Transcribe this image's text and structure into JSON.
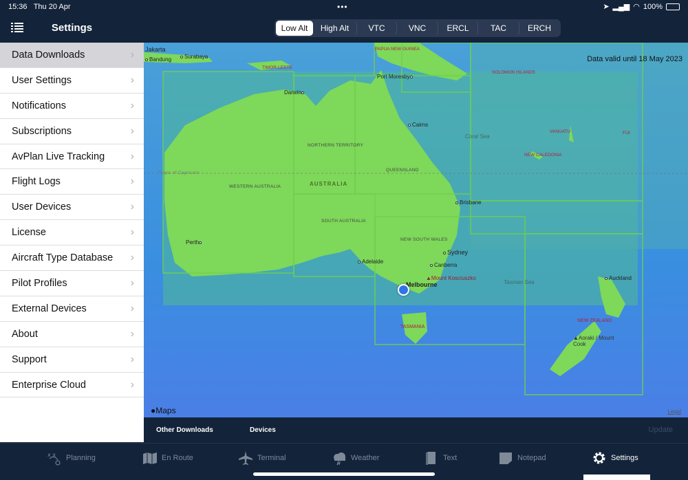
{
  "status": {
    "time": "15:36",
    "date": "Thu 20 Apr",
    "battery": "100%",
    "dots": "•••"
  },
  "sidebar": {
    "title": "Settings",
    "items": [
      {
        "label": "Data Downloads",
        "active": true
      },
      {
        "label": "User Settings"
      },
      {
        "label": "Notifications"
      },
      {
        "label": "Subscriptions"
      },
      {
        "label": "AvPlan Live Tracking"
      },
      {
        "label": "Flight Logs"
      },
      {
        "label": "User Devices"
      },
      {
        "label": "License"
      },
      {
        "label": "Aircraft Type Database"
      },
      {
        "label": "Pilot Profiles"
      },
      {
        "label": "External Devices"
      },
      {
        "label": "About"
      },
      {
        "label": "Support"
      },
      {
        "label": "Enterprise Cloud"
      }
    ]
  },
  "chart_tabs": [
    {
      "label": "Low Alt",
      "selected": true
    },
    {
      "label": "High Alt"
    },
    {
      "label": "VTC"
    },
    {
      "label": "VNC"
    },
    {
      "label": "ERCL"
    },
    {
      "label": "TAC"
    },
    {
      "label": "ERCH"
    }
  ],
  "map": {
    "validity": "Data valid until 18 May 2023",
    "attribution": "Maps",
    "legal": "Legal",
    "labels": {
      "jakarta": "Jakarta",
      "bandung": "Bandung",
      "surabaya": "Surabaya",
      "timor_leste": "TIMOR-LESTE",
      "png": "PAPUA NEW GUINEA",
      "port_moresby": "Port Moresby",
      "solomon": "SOLOMON ISLANDS",
      "darwin": "Darwin",
      "cairns": "Cairns",
      "coral_sea": "Coral Sea",
      "vanuatu": "VANUATU",
      "fiji": "FIJI",
      "new_caledonia": "NEW CALEDONIA",
      "northern_territory": "NORTHERN TERRITORY",
      "australia": "AUSTRALIA",
      "queensland": "QUEENSLAND",
      "tropic": "Tropic of Capricorn",
      "western_australia": "WESTERN AUSTRALIA",
      "brisbane": "Brisbane",
      "south_australia": "SOUTH AUSTRALIA",
      "perth": "Perth",
      "nsw": "NEW SOUTH WALES",
      "sydney": "Sydney",
      "adelaide": "Adelaide",
      "canberra": "Canberra",
      "kosciuszko": "Mount Kosciuszko",
      "melbourne": "Melbourne",
      "tasman_sea": "Tasman Sea",
      "auckland": "Auckland",
      "tasmania": "TASMANIA",
      "new_zealand": "NEW ZEALAND",
      "aoraki": "Aoraki / Mount Cook"
    }
  },
  "subbar": {
    "other_downloads": "Other Downloads",
    "devices": "Devices",
    "update": "Update"
  },
  "tabbar": [
    {
      "label": "Planning",
      "icon": "planning-icon"
    },
    {
      "label": "En Route",
      "icon": "map-icon"
    },
    {
      "label": "Terminal",
      "icon": "airplane-icon"
    },
    {
      "label": "Weather",
      "icon": "weather-icon"
    },
    {
      "label": "Text",
      "icon": "book-icon"
    },
    {
      "label": "Notepad",
      "icon": "notepad-icon"
    },
    {
      "label": "Settings",
      "icon": "gear-icon",
      "active": true
    }
  ],
  "colors": {
    "land": "#7ed85a",
    "water": "#3c8fe0",
    "chrome": "#13233a",
    "location": "#2f74e8"
  }
}
